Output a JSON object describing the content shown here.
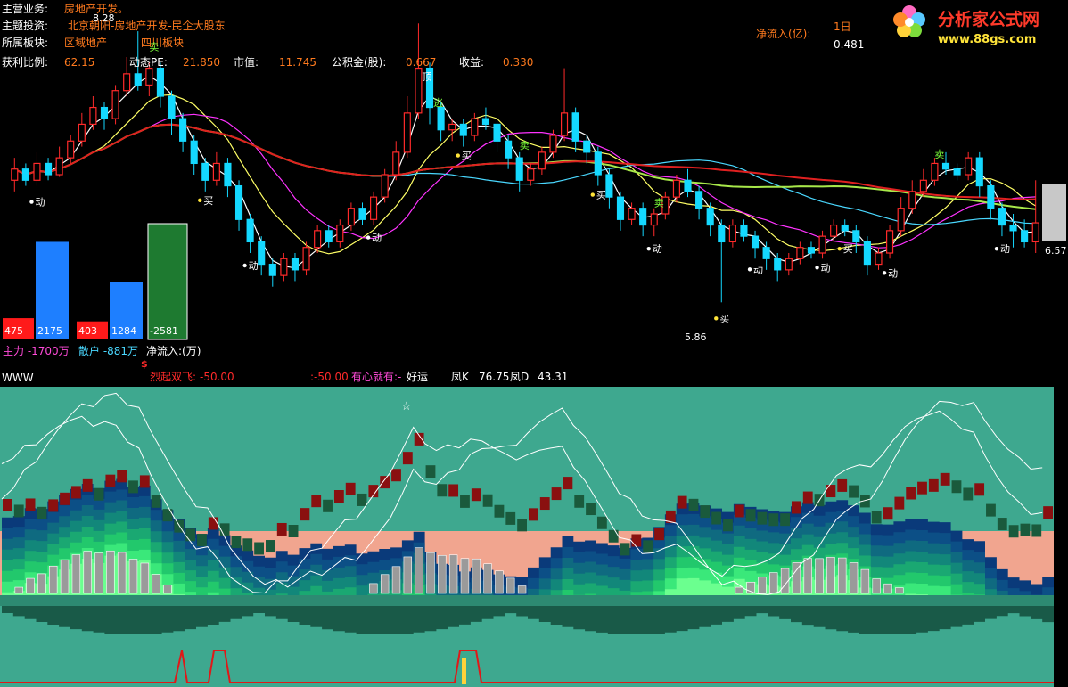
{
  "info": {
    "main_business_label": "主营业务:",
    "main_business_value": "房地产开发。",
    "theme_label": "主题投资:",
    "theme_value": "北京朝阳-房地产开发-民企大股东",
    "sector_label": "所属板块:",
    "sector_value_1": "区域地产",
    "sector_value_2": "四川板块",
    "profit_ratio_label": "获利比例:",
    "profit_ratio_value": "62.15",
    "pe_label": "动态PE:",
    "pe_value": "21.850",
    "mcap_label": "市值:",
    "mcap_value": "11.745",
    "reserve_label": "公积金(股):",
    "reserve_value": "0.667",
    "eps_label": "收益:",
    "eps_value": "0.330",
    "netflow_label": "净流入(亿):",
    "period_label": "1日",
    "netflow_value": "0.481",
    "top_price": "8.28",
    "low_price_label": "5.86",
    "right_price_label": "6.57"
  },
  "logo": {
    "text": "分析家公式网",
    "url_text": "www.88gs.com"
  },
  "signals": {
    "buy": "买",
    "sell": "卖",
    "move": "动",
    "top": "顶",
    "escape": "逃",
    "dollar": "$",
    "star": "☆"
  },
  "flow": {
    "zhuli_label": "主力 -1700万",
    "sanhu_label": "散户 -881万",
    "net_label": "净流入:(万)",
    "bars": [
      {
        "value": 475,
        "label": "475",
        "color": "#ff1a1a"
      },
      {
        "value": 2175,
        "label": "2175",
        "color": "#1e7fff"
      },
      {
        "value": 403,
        "label": "403",
        "color": "#ff1a1a"
      },
      {
        "value": 1284,
        "label": "1284",
        "color": "#1e7fff"
      },
      {
        "value": -2581,
        "label": "-2581",
        "color": "#1e7a30"
      }
    ]
  },
  "lower_panel": {
    "title": "WWW",
    "line1_label": "烈起双飞:",
    "line1_value": "-50.00",
    "line2_value": ":-50.00",
    "phrase": "有心就有:-",
    "lucky": "好运",
    "k_label": "凤K",
    "k_value": "76.75",
    "d_label": "凤D",
    "d_value": "43.31"
  },
  "chart_data": {
    "type": "candlestick",
    "price_range": [
      5.6,
      8.4
    ],
    "candles": [
      [
        6.95,
        7.05,
        7.15,
        6.85
      ],
      [
        7.05,
        6.95,
        7.1,
        6.9
      ],
      [
        6.95,
        7.1,
        7.2,
        6.9
      ],
      [
        7.1,
        7.0,
        7.15,
        6.95
      ],
      [
        7.0,
        7.15,
        7.25,
        6.98
      ],
      [
        7.15,
        7.3,
        7.35,
        7.1
      ],
      [
        7.3,
        7.45,
        7.55,
        7.25
      ],
      [
        7.45,
        7.6,
        7.7,
        7.4
      ],
      [
        7.6,
        7.5,
        7.65,
        7.4
      ],
      [
        7.5,
        7.75,
        7.8,
        7.45
      ],
      [
        7.75,
        7.9,
        8.05,
        7.7
      ],
      [
        7.9,
        7.8,
        8.28,
        7.75
      ],
      [
        7.8,
        7.95,
        8.0,
        7.7
      ],
      [
        7.95,
        7.7,
        8.0,
        7.6
      ],
      [
        7.7,
        7.5,
        7.75,
        7.35
      ],
      [
        7.5,
        7.3,
        7.55,
        7.2
      ],
      [
        7.3,
        7.1,
        7.35,
        7.0
      ],
      [
        7.1,
        6.95,
        7.15,
        6.85
      ],
      [
        6.95,
        7.1,
        7.2,
        6.9
      ],
      [
        7.1,
        6.9,
        7.15,
        6.8
      ],
      [
        6.9,
        6.6,
        6.95,
        6.5
      ],
      [
        6.6,
        6.4,
        6.65,
        6.3
      ],
      [
        6.4,
        6.2,
        6.45,
        6.1
      ],
      [
        6.2,
        6.1,
        6.25,
        6.0
      ],
      [
        6.1,
        6.25,
        6.3,
        6.05
      ],
      [
        6.25,
        6.15,
        6.3,
        6.05
      ],
      [
        6.15,
        6.35,
        6.4,
        6.1
      ],
      [
        6.35,
        6.5,
        6.55,
        6.3
      ],
      [
        6.5,
        6.4,
        6.55,
        6.35
      ],
      [
        6.4,
        6.55,
        6.6,
        6.35
      ],
      [
        6.55,
        6.7,
        6.75,
        6.5
      ],
      [
        6.7,
        6.6,
        6.75,
        6.55
      ],
      [
        6.6,
        6.8,
        6.85,
        6.55
      ],
      [
        6.8,
        7.0,
        7.05,
        6.75
      ],
      [
        7.0,
        7.2,
        7.3,
        6.95
      ],
      [
        7.2,
        7.55,
        7.7,
        7.15
      ],
      [
        7.55,
        7.95,
        8.35,
        7.5
      ],
      [
        7.95,
        7.6,
        8.0,
        7.45
      ],
      [
        7.6,
        7.4,
        7.65,
        7.3
      ],
      [
        7.4,
        7.45,
        7.5,
        7.3
      ],
      [
        7.45,
        7.35,
        7.5,
        7.25
      ],
      [
        7.35,
        7.5,
        7.55,
        7.3
      ],
      [
        7.5,
        7.45,
        7.6,
        7.4
      ],
      [
        7.45,
        7.3,
        7.5,
        7.2
      ],
      [
        7.3,
        7.15,
        7.35,
        7.05
      ],
      [
        7.15,
        6.95,
        7.2,
        6.85
      ],
      [
        6.95,
        7.05,
        7.1,
        6.9
      ],
      [
        7.05,
        7.2,
        7.25,
        7.0
      ],
      [
        7.2,
        7.35,
        7.4,
        7.15
      ],
      [
        7.35,
        7.55,
        7.95,
        7.3
      ],
      [
        7.55,
        7.3,
        7.6,
        7.2
      ],
      [
        7.3,
        7.2,
        7.35,
        7.1
      ],
      [
        7.2,
        7.0,
        7.25,
        6.9
      ],
      [
        7.0,
        6.8,
        7.05,
        6.7
      ],
      [
        6.8,
        6.6,
        6.85,
        6.5
      ],
      [
        6.6,
        6.7,
        6.75,
        6.55
      ],
      [
        6.7,
        6.55,
        6.75,
        6.45
      ],
      [
        6.55,
        6.65,
        6.7,
        6.45
      ],
      [
        6.65,
        6.8,
        6.85,
        6.6
      ],
      [
        6.8,
        6.95,
        7.0,
        6.75
      ],
      [
        6.95,
        6.85,
        7.05,
        6.8
      ],
      [
        6.85,
        6.7,
        6.9,
        6.6
      ],
      [
        6.7,
        6.55,
        6.75,
        6.45
      ],
      [
        6.55,
        6.4,
        6.6,
        5.86
      ],
      [
        6.4,
        6.55,
        6.6,
        6.35
      ],
      [
        6.55,
        6.45,
        6.6,
        6.4
      ],
      [
        6.45,
        6.35,
        6.5,
        6.25
      ],
      [
        6.35,
        6.25,
        6.4,
        6.15
      ],
      [
        6.25,
        6.15,
        6.3,
        6.05
      ],
      [
        6.15,
        6.25,
        6.3,
        6.1
      ],
      [
        6.25,
        6.35,
        6.4,
        6.2
      ],
      [
        6.35,
        6.3,
        6.4,
        6.25
      ],
      [
        6.3,
        6.45,
        6.5,
        6.25
      ],
      [
        6.45,
        6.55,
        6.6,
        6.4
      ],
      [
        6.55,
        6.5,
        6.6,
        6.45
      ],
      [
        6.5,
        6.4,
        6.55,
        6.3
      ],
      [
        6.4,
        6.2,
        6.45,
        6.1
      ],
      [
        6.2,
        6.3,
        6.35,
        6.15
      ],
      [
        6.3,
        6.5,
        6.55,
        6.25
      ],
      [
        6.5,
        6.7,
        6.8,
        6.45
      ],
      [
        6.7,
        6.85,
        6.95,
        6.65
      ],
      [
        6.85,
        6.95,
        7.05,
        6.8
      ],
      [
        6.95,
        7.1,
        7.15,
        6.9
      ],
      [
        7.1,
        7.05,
        7.2,
        7.0
      ],
      [
        7.05,
        7.0,
        7.1,
        6.95
      ],
      [
        7.0,
        7.15,
        7.2,
        6.95
      ],
      [
        7.15,
        6.9,
        7.2,
        6.8
      ],
      [
        6.9,
        6.7,
        6.95,
        6.6
      ],
      [
        6.7,
        6.55,
        6.75,
        6.45
      ],
      [
        6.55,
        6.5,
        6.65,
        6.35
      ],
      [
        6.5,
        6.4,
        6.6,
        6.35
      ],
      [
        6.4,
        6.57,
        6.95,
        6.3
      ]
    ]
  },
  "colors": {
    "up": "#ff2a2a",
    "down": "#14d8ff",
    "teal_bg": "#3ea88f",
    "salmon": "#f1a58f"
  }
}
